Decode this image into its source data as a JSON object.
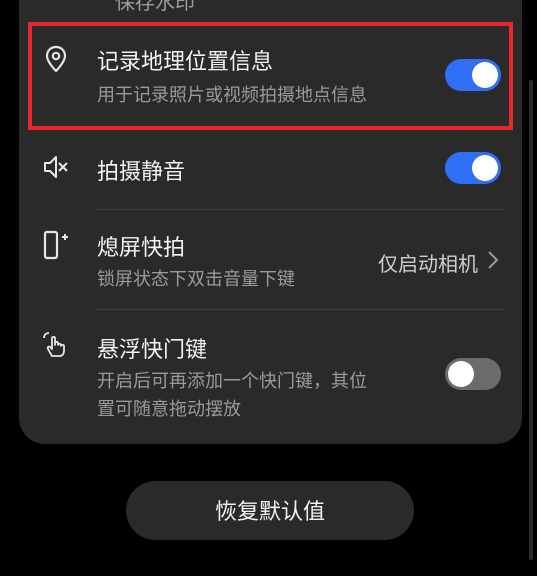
{
  "top_cut_text": "保存水印",
  "settings": [
    {
      "title": "记录地理位置信息",
      "subtitle": "用于记录照片或视频拍摄地点信息",
      "toggle": "on",
      "icon": "location-pin-icon"
    },
    {
      "title": "拍摄静音",
      "toggle": "on",
      "icon": "mute-speaker-icon"
    },
    {
      "title": "熄屏快拍",
      "subtitle": "锁屏状态下双击音量下键",
      "value": "仅启动相机",
      "icon": "screen-off-snapshot-icon"
    },
    {
      "title": "悬浮快门键",
      "subtitle_line1": "开启后可再添加一个快门键，其位",
      "subtitle_line2": "置可随意拖动摆放",
      "toggle": "off",
      "icon": "touch-hand-icon"
    }
  ],
  "reset_label": "恢复默认值",
  "colors": {
    "accent": "#2f6ef5",
    "highlight": "#e8262b",
    "card": "#2a2a2a"
  }
}
